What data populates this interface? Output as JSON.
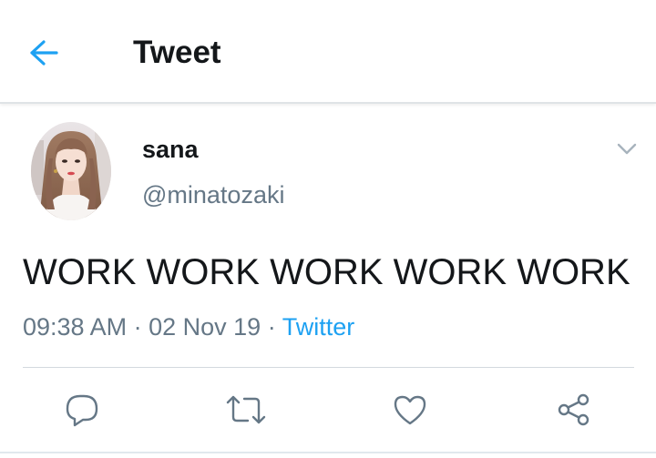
{
  "header": {
    "title": "Tweet",
    "back_icon": "arrow-left-icon"
  },
  "tweet": {
    "author": {
      "display_name": "sana",
      "handle": "@minatozaki",
      "avatar_icon": "profile-photo"
    },
    "text": "WORK WORK WORK WORK WORK",
    "time": "09:38 AM",
    "separator": "·",
    "date": "02 Nov 19",
    "source": "Twitter",
    "menu_icon": "chevron-down-icon"
  },
  "actions": [
    {
      "name": "reply",
      "icon": "reply-icon"
    },
    {
      "name": "retweet",
      "icon": "retweet-icon"
    },
    {
      "name": "like",
      "icon": "heart-icon"
    },
    {
      "name": "share",
      "icon": "share-icon"
    }
  ],
  "colors": {
    "accent": "#1da1f2",
    "text_primary": "#14171a",
    "text_secondary": "#657786",
    "icon": "#657786",
    "divider": "#d3d9de"
  }
}
